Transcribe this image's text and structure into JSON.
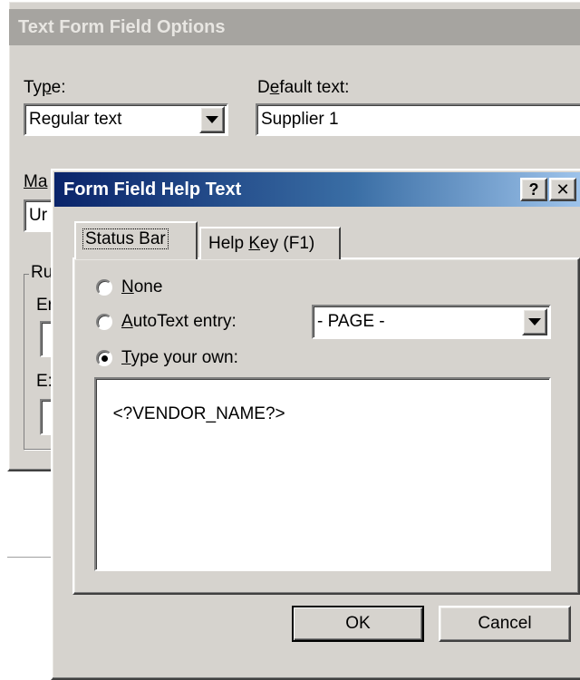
{
  "bg_dialog": {
    "title": "Text Form Field Options",
    "type_label_pre": "Ty",
    "type_label_u": "p",
    "type_label_post": "e:",
    "type_value": "Regular text",
    "default_label_pre": "D",
    "default_label_u": "e",
    "default_label_post": "fault text:",
    "default_value": "Supplier 1",
    "max_label_partial": "Ma",
    "max_value_partial": "Ur",
    "group_label_partial": "Ru",
    "row1_label_partial": "Er",
    "row2_label_partial": "E:"
  },
  "dialog": {
    "title": "Form Field Help Text",
    "help_button": "?",
    "close_button": "✕",
    "tabs": [
      {
        "label": "Status Bar"
      },
      {
        "label_pre": "Help ",
        "label_u": "K",
        "label_post": "ey (F1)"
      }
    ],
    "options": [
      {
        "label_u": "N",
        "label_post": "one",
        "checked": false
      },
      {
        "label_u": "A",
        "label_post": "utoText entry:",
        "checked": false
      },
      {
        "label_u": "T",
        "label_post": "ype your own:",
        "checked": true
      }
    ],
    "autotext_value": "- PAGE -",
    "text_value": "<?VENDOR_NAME?>",
    "ok_label": "OK",
    "cancel_label": "Cancel"
  }
}
